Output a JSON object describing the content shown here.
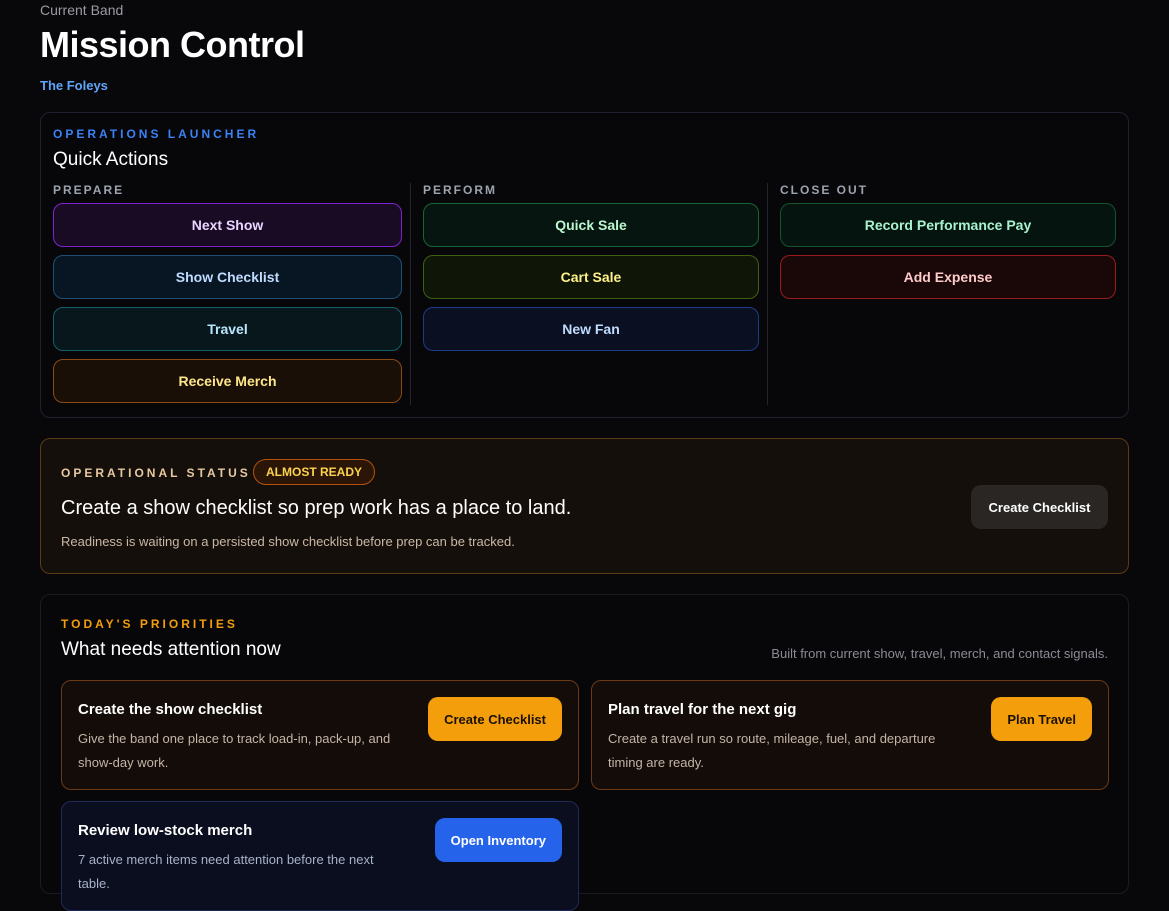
{
  "header": {
    "label": "Current Band",
    "title": "Mission Control",
    "band_name": "The Foleys"
  },
  "launcher": {
    "eyebrow": "Operations Launcher",
    "title": "Quick Actions",
    "columns": [
      {
        "label": "PREPARE",
        "actions": [
          "Next Show",
          "Show Checklist",
          "Travel",
          "Receive Merch"
        ]
      },
      {
        "label": "PERFORM",
        "actions": [
          "Quick Sale",
          "Cart Sale",
          "New Fan"
        ]
      },
      {
        "label": "CLOSE OUT",
        "actions": [
          "Record Performance Pay",
          "Add Expense"
        ]
      }
    ]
  },
  "status": {
    "eyebrow": "Operational Status",
    "badge": "ALMOST READY",
    "headline": "Create a show checklist so prep work has a place to land.",
    "subtext": "Readiness is waiting on a persisted show checklist before prep can be tracked.",
    "action": "Create Checklist"
  },
  "priorities": {
    "eyebrow": "Today's Priorities",
    "title": "What needs attention now",
    "note": "Built from current show, travel, merch, and contact signals.",
    "items": [
      {
        "title": "Create the show checklist",
        "body": "Give the band one place to track load-in, pack-up, and show-day work.",
        "action": "Create Checklist"
      },
      {
        "title": "Plan travel for the next gig",
        "body": "Create a travel run so route, mileage, fuel, and departure timing are ready.",
        "action": "Plan Travel"
      },
      {
        "title": "Review low-stock merch",
        "body": "7 active merch items need attention before the next table.",
        "action": "Open Inventory"
      }
    ]
  }
}
